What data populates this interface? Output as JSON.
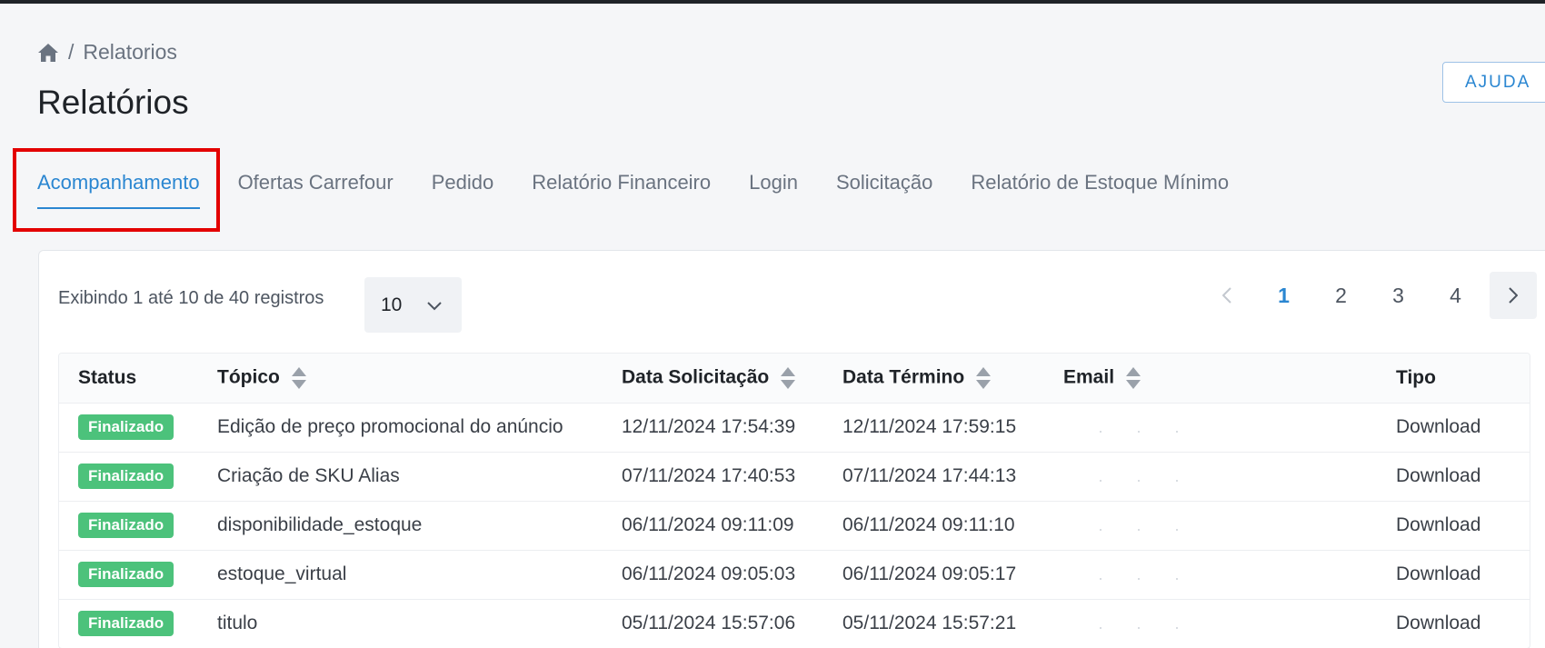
{
  "breadcrumb": {
    "current": "Relatorios",
    "separator": "/"
  },
  "page": {
    "title": "Relatórios"
  },
  "help_button": "AJUDA",
  "tabs": [
    {
      "label": "Acompanhamento",
      "active": true
    },
    {
      "label": "Ofertas Carrefour",
      "active": false
    },
    {
      "label": "Pedido",
      "active": false
    },
    {
      "label": "Relatório Financeiro",
      "active": false
    },
    {
      "label": "Login",
      "active": false
    },
    {
      "label": "Solicitação",
      "active": false
    },
    {
      "label": "Relatório de Estoque Mínimo",
      "active": false
    }
  ],
  "listing": {
    "showing_text": "Exibindo 1 até 10 de 40 registros",
    "page_size": "10"
  },
  "pagination": {
    "pages": [
      "1",
      "2",
      "3",
      "4"
    ],
    "current": "1"
  },
  "table": {
    "columns": [
      "Status",
      "Tópico",
      "Data Solicitação",
      "Data Término",
      "Email",
      "Tipo"
    ],
    "rows": [
      {
        "status": "Finalizado",
        "topic": "Edição de preço promocional do anúncio",
        "requested": "12/11/2024 17:54:39",
        "finished": "12/11/2024 17:59:15",
        "email": "",
        "type": "Download"
      },
      {
        "status": "Finalizado",
        "topic": "Criação de SKU Alias",
        "requested": "07/11/2024 17:40:53",
        "finished": "07/11/2024 17:44:13",
        "email": "",
        "type": "Download"
      },
      {
        "status": "Finalizado",
        "topic": "disponibilidade_estoque",
        "requested": "06/11/2024 09:11:09",
        "finished": "06/11/2024 09:11:10",
        "email": "",
        "type": "Download"
      },
      {
        "status": "Finalizado",
        "topic": "estoque_virtual",
        "requested": "06/11/2024 09:05:03",
        "finished": "06/11/2024 09:05:17",
        "email": "",
        "type": "Download"
      },
      {
        "status": "Finalizado",
        "topic": "titulo",
        "requested": "05/11/2024 15:57:06",
        "finished": "05/11/2024 15:57:21",
        "email": "",
        "type": "Download"
      }
    ]
  },
  "colors": {
    "accent": "#2a86d1",
    "status_success": "#4cc27b",
    "highlight": "#e30000"
  },
  "icons": [
    "home-icon",
    "chevron-down-icon",
    "chevron-left-icon",
    "chevron-right-icon",
    "sort-icon"
  ]
}
